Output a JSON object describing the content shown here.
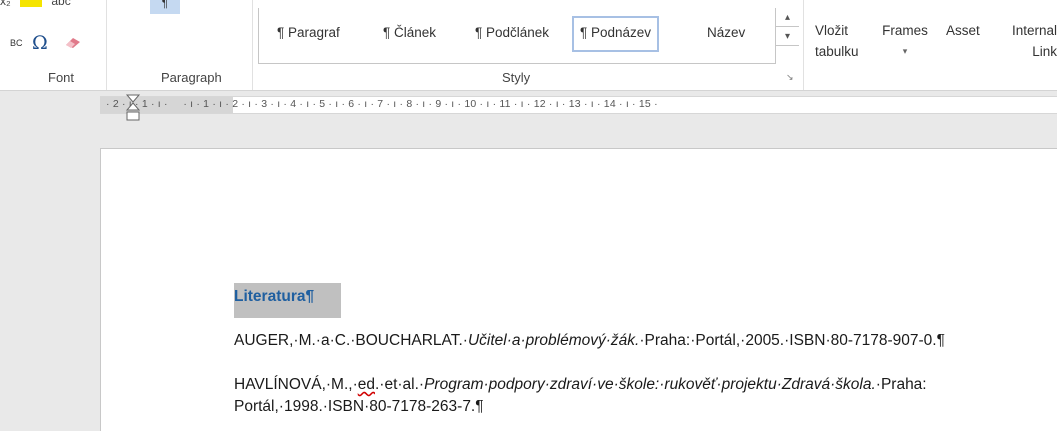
{
  "ribbon": {
    "font_group": {
      "label": "Font",
      "top_row_text": "x₂",
      "strike_label": "abc",
      "caps_label": "BC",
      "symbol": "Ω"
    },
    "paragraph_group": {
      "label": "Paragraph",
      "pilcrow_button": "¶"
    },
    "styles_group": {
      "label": "Styly",
      "items": [
        {
          "label": "¶ Paragraf"
        },
        {
          "label": "¶ Článek"
        },
        {
          "label": "¶ Podčlánek"
        },
        {
          "label": "¶ Podnázev",
          "selected": true
        },
        {
          "label": "Název"
        }
      ],
      "scroll_up": "▴",
      "scroll_more": "▾",
      "launcher": "↘"
    },
    "commands": [
      {
        "line1": "Vložit",
        "line2": "tabulku"
      },
      {
        "line1": "Frames",
        "line2": "▾"
      },
      {
        "line1": "Asset",
        "line2": ""
      },
      {
        "line1": "Internal",
        "line2": "Link"
      }
    ]
  },
  "ruler": {
    "text": "· 2 · ı · 1 · ı ·     · ı · 1 · ı · 2 · ı · 3 · ı · 4 · ı · 5 · ı · 6 · ı · 7 · ı · 8 · ı · 9 · ı · 10 · ı · 11 · ı · 12 · ı · 13 · ı · 14 · ı · 15 ·"
  },
  "document": {
    "heading": "Literatura¶",
    "references": [
      {
        "authors": "AUGER,·M.·a·C.·BOUCHARLAT.·",
        "title": "Učitel·a·problémový·žák.",
        "rest": "·Praha:·Portál,·2005.·ISBN·80-7178-907-0.¶"
      },
      {
        "authors_a": "HAVLÍNOVÁ,·M.,·",
        "ed": "ed",
        "authors_b": ".·et·al.·",
        "title": "Program·podpory·zdraví·ve·škole:·rukověť·projektu·Zdravá·škola.",
        "rest": "·Praha:",
        "line2": "Portál,·1998.·ISBN·80-7178-263-7.¶"
      }
    ]
  },
  "colors": {
    "heading_text": "#1f5fa0",
    "heading_highlight": "#c0c0c0",
    "selected_style_border": "#a7c0e4",
    "spell_error": "#d00000"
  }
}
